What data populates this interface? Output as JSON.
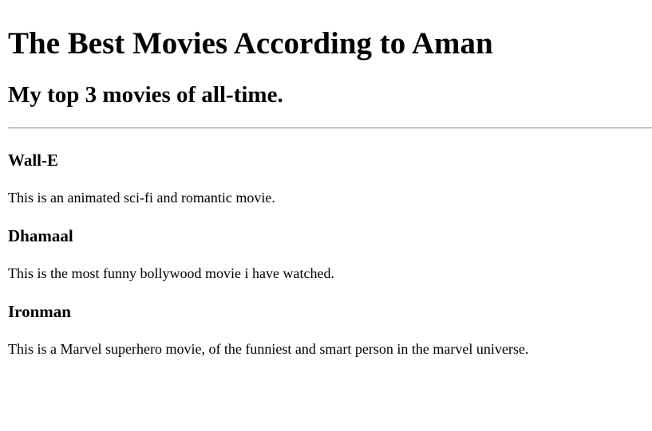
{
  "title": "The Best Movies According to Aman",
  "subtitle": "My top 3 movies of all-time.",
  "movies": [
    {
      "name": "Wall-E",
      "description": "This is an animated sci-fi and romantic movie."
    },
    {
      "name": "Dhamaal",
      "description": "This is the most funny bollywood movie i have watched."
    },
    {
      "name": "Ironman",
      "description": "This is a Marvel superhero movie, of the funniest and smart person in the marvel universe."
    }
  ]
}
